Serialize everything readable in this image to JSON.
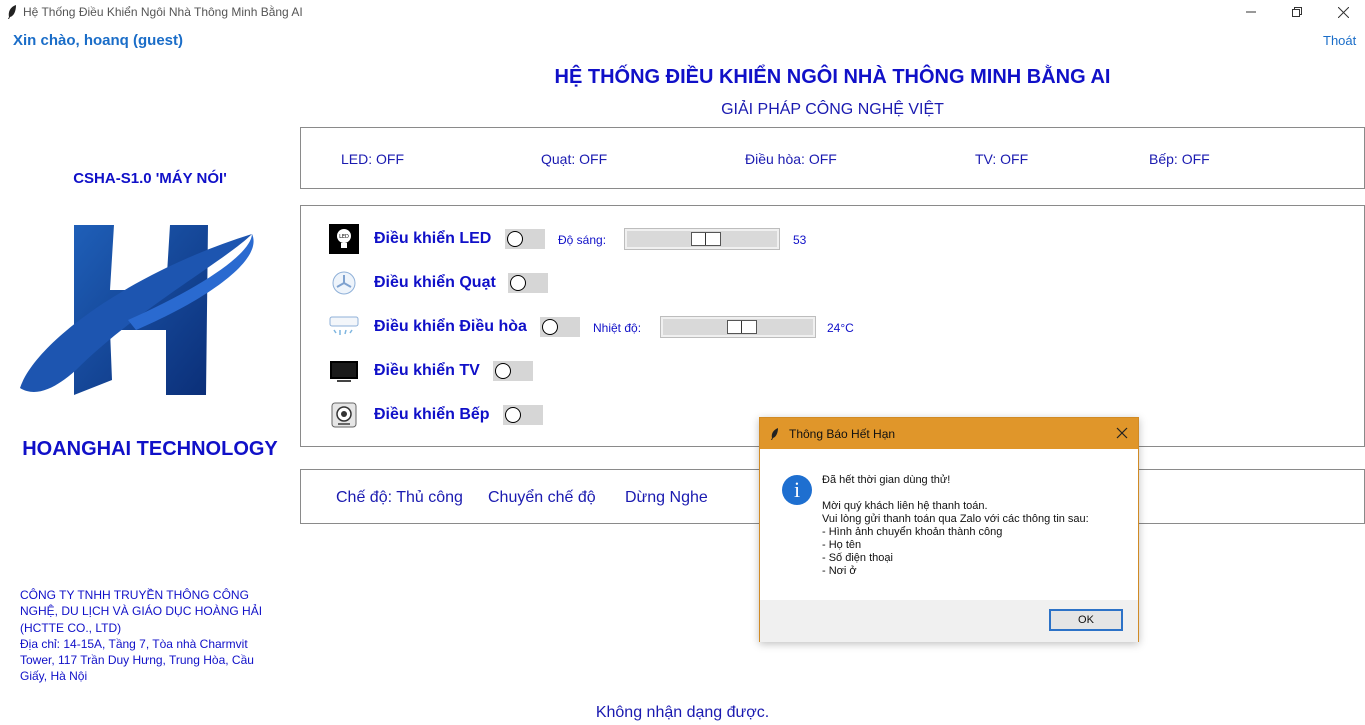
{
  "window": {
    "title": "Hệ Thống Điều Khiển Ngôi Nhà Thông Minh Bằng AI"
  },
  "header": {
    "greeting": "Xin chào, hoanq (guest)",
    "logout": "Thoát",
    "title": "HỆ THỐNG ĐIỀU KHIỂN NGÔI NHÀ THÔNG MINH BẰNG AI",
    "subtitle": "GIẢI PHÁP CÔNG NGHỆ VIỆT"
  },
  "brand": {
    "model": "CSHA-S1.0 'MÁY NÓI'",
    "name": "HOANGHAI TECHNOLOGY",
    "company_lines": [
      "CÔNG TY TNHH TRUYỀN THÔNG CÔNG",
      "NGHỆ, DU LỊCH VÀ GIÁO DỤC HOÀNG HẢI",
      "(HCTTE CO., LTD)",
      "Địa chỉ: 14-15A, Tầng 7, Tòa nhà Charmvit",
      "Tower, 117 Trần Duy Hưng, Trung Hòa, Cầu",
      "Giấy, Hà Nội"
    ],
    "colors": {
      "primary": "#1010c8",
      "accent": "#1a6dc8"
    }
  },
  "status": [
    "LED: OFF",
    "Quạt: OFF",
    "Điều hòa: OFF",
    "TV: OFF",
    "Bếp: OFF"
  ],
  "controls": {
    "led": {
      "label": "Điều khiển LED",
      "on": false,
      "slider_label": "Độ sáng:",
      "slider_value": "53",
      "slider_fraction": 0.53
    },
    "fan": {
      "label": "Điều khiển Quạt",
      "on": false
    },
    "ac": {
      "label": "Điều khiển Điều hòa",
      "on": false,
      "slider_label": "Nhiệt độ:",
      "slider_value": "24°C",
      "slider_fraction": 0.53
    },
    "tv": {
      "label": "Điều khiển TV",
      "on": false
    },
    "stove": {
      "label": "Điều khiển Bếp",
      "on": false
    }
  },
  "mode": {
    "current": "Chế độ: Thủ công",
    "switch": "Chuyển chế độ",
    "stop": "Dừng Nghe"
  },
  "recognition": "Không nhận dạng được.",
  "dialog": {
    "title": "Thông Báo Hết Hạn",
    "lines_1": [
      "Đã hết thời gian dùng thử!"
    ],
    "lines_2": [
      "Mời quý khách liên hệ thanh toán.",
      "Vui lòng gửi thanh toán qua Zalo với các thông tin sau:",
      "- Hình ảnh chuyển khoản thành công",
      "- Họ tên",
      "- Số điện thoại",
      "- Nơi ở"
    ],
    "ok": "OK",
    "colors": {
      "titlebar": "#e0962a",
      "info": "#1e6fd0"
    }
  }
}
